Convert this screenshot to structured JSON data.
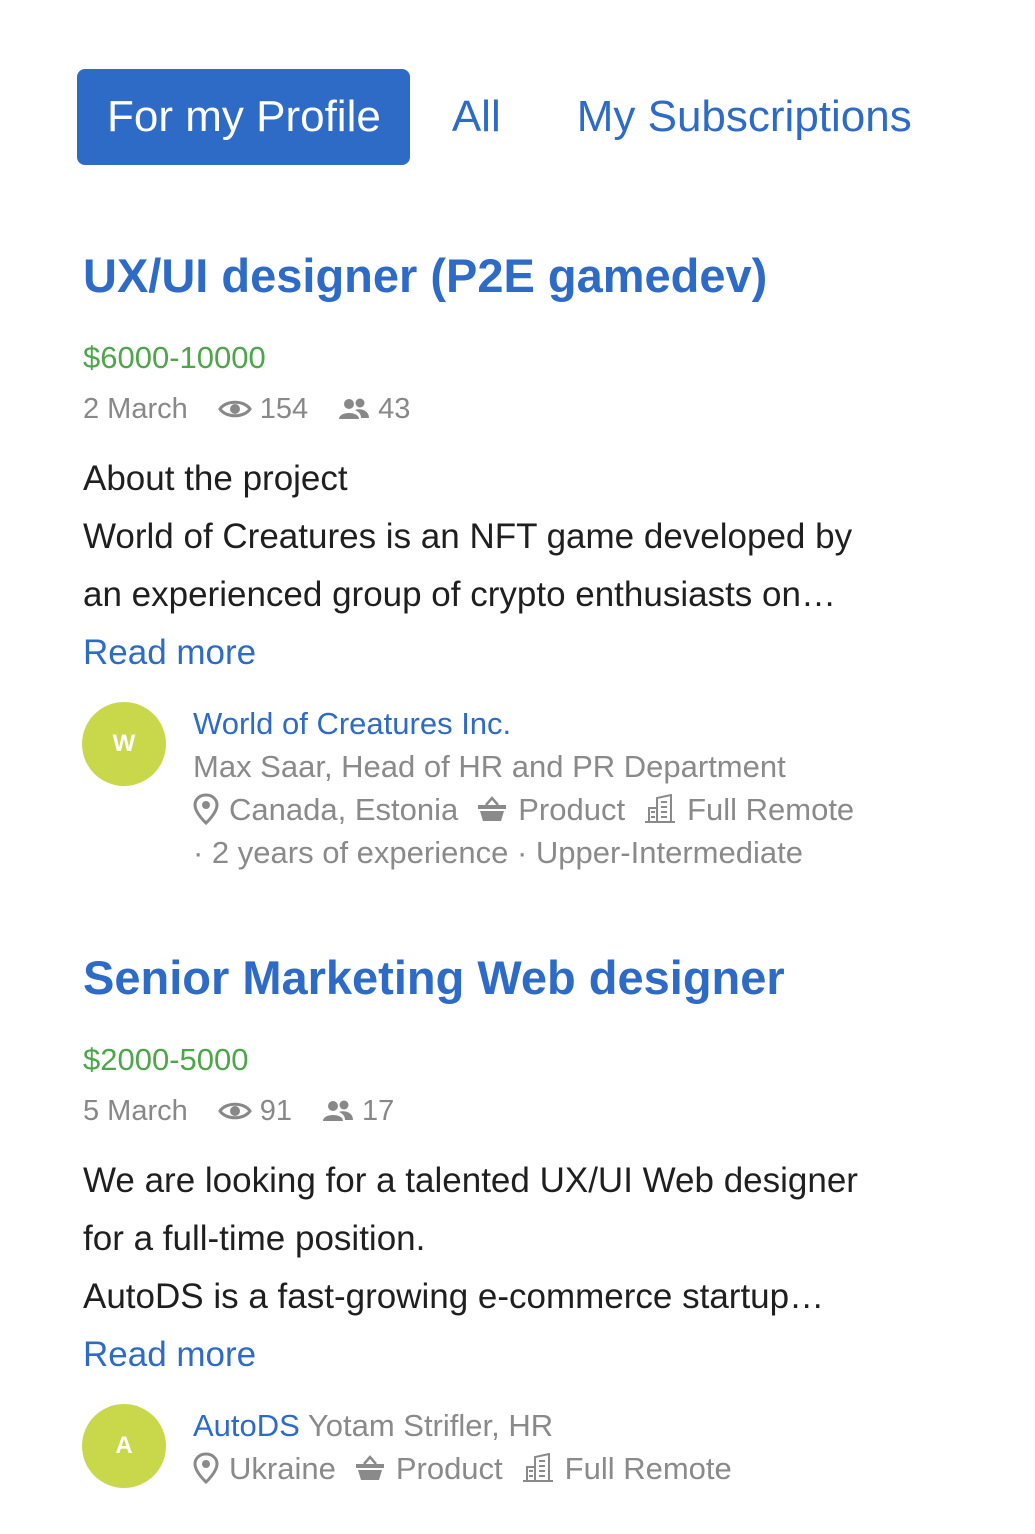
{
  "tabs": [
    {
      "label": "For my Profile",
      "active": true
    },
    {
      "label": "All",
      "active": false
    },
    {
      "label": "My Subscriptions",
      "active": false
    }
  ],
  "vacancies": [
    {
      "title": "UX/UI designer (P2E gamedev)",
      "salary": "$6000-10000",
      "date": "2 March",
      "views": "154",
      "applicants": "43",
      "description": [
        "About the project",
        "World of Creatures is an NFT game developed by",
        "an experienced group of crypto enthusiasts on…"
      ],
      "read_more": "Read more",
      "avatar_letter": "W",
      "company": "World of Creatures Inc.",
      "recruiter": "Max Saar, Head of HR and PR Department",
      "location": "Canada, Estonia",
      "company_type": "Product",
      "work_mode": "Full Remote",
      "extra": "· 2 years of experience · Upper-Intermediate"
    },
    {
      "title": "Senior Marketing Web designer",
      "salary": "$2000-5000",
      "date": "5 March",
      "views": "91",
      "applicants": "17",
      "description": [
        "We are looking for a talented UX/UI Web designer",
        "for a full-time position.",
        "AutoDS is a fast-growing e-commerce startup…"
      ],
      "read_more": "Read more",
      "avatar_letter": "A",
      "company": "AutoDS",
      "recruiter": "Yotam Strifler, HR",
      "location": "Ukraine",
      "company_type": "Product",
      "work_mode": "Full Remote"
    }
  ],
  "colors": {
    "accent": "#2d6bc7",
    "salary": "#4da64a",
    "muted": "#888888",
    "avatar": "#c9d84a"
  }
}
